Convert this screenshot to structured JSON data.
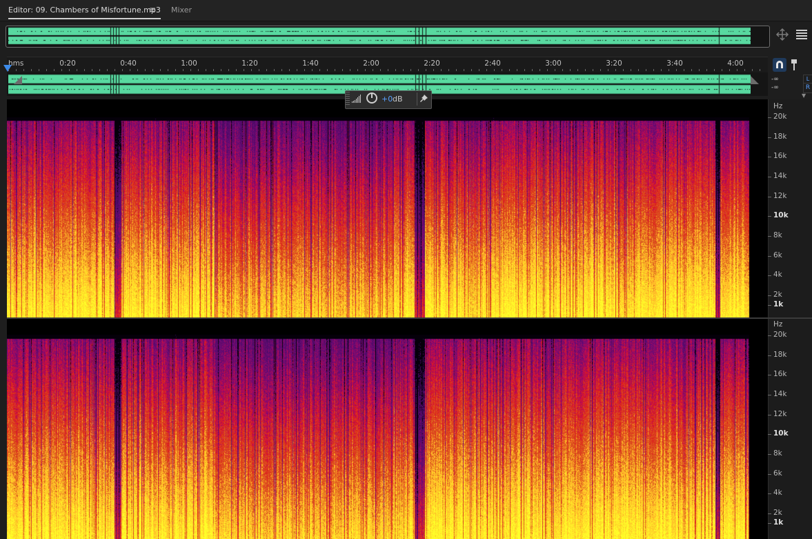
{
  "tabs": {
    "editor_label": "Editor: 09. Chambers of Misfortune.mp3",
    "menu_icon": "≡",
    "mixer_label": "Mixer"
  },
  "ruler": {
    "unit": "hms",
    "ticks": [
      "0:20",
      "0:40",
      "1:00",
      "1:20",
      "1:40",
      "2:00",
      "2:20",
      "2:40",
      "3:00",
      "3:20",
      "3:40",
      "4:00"
    ]
  },
  "meters": {
    "left": "-∞",
    "right": "-∞",
    "channel_top": "L",
    "channel_r": "R"
  },
  "hud": {
    "value_num": "+0",
    "value_unit": "dB"
  },
  "freq_axis": {
    "unit": "Hz",
    "labels": [
      "20k",
      "18k",
      "16k",
      "14k",
      "12k",
      "10k",
      "8k",
      "6k",
      "4k",
      "2k",
      "1k"
    ]
  },
  "colors": {
    "waveform": "#58d9a0",
    "accent": "#3d8bea",
    "spectral_hot": "#ffd060",
    "spectral_mid": "#e01020",
    "spectral_low": "#6a1a9a"
  },
  "icons": {
    "zoom_nav": "zoom-navigator-icon",
    "list": "list-icon",
    "snap": "snap-magnet-icon",
    "pin": "pin-icon"
  }
}
